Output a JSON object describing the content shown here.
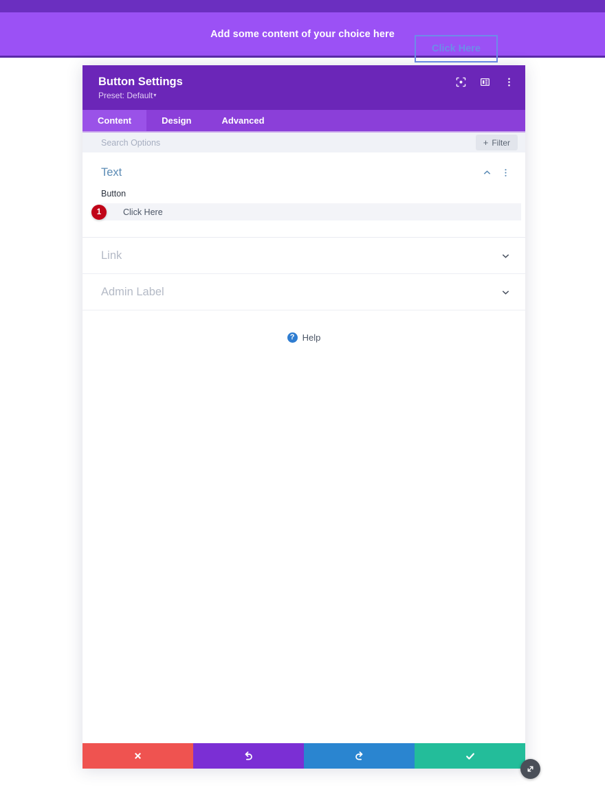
{
  "site_banner": {
    "text": "Add some content of your choice here",
    "cta_label": "Click Here",
    "bg_color": "#9b51f5",
    "top_strip_color": "#6b2fc0",
    "cta_border_color": "#6d8ce8"
  },
  "modal": {
    "title": "Button Settings",
    "preset_label": "Preset: Default",
    "preset_caret": "▾",
    "header_bg": "#6b26b8",
    "header_icons": [
      {
        "name": "focus-icon"
      },
      {
        "name": "layout-columns-icon"
      },
      {
        "name": "more-vertical-icon"
      }
    ],
    "tabs": [
      {
        "label": "Content",
        "active": true
      },
      {
        "label": "Design",
        "active": false
      },
      {
        "label": "Advanced",
        "active": false
      }
    ],
    "search": {
      "placeholder": "Search Options",
      "value": ""
    },
    "filter_button": {
      "label": "Filter",
      "plus": "+"
    },
    "sections": [
      {
        "title": "Text",
        "expanded": true,
        "title_color": "#5b8bb5",
        "fields": [
          {
            "label": "Button",
            "value": "Click Here",
            "step_badge": "1",
            "step_badge_color": "#c00418"
          }
        ]
      },
      {
        "title": "Link",
        "expanded": false
      },
      {
        "title": "Admin Label",
        "expanded": false
      }
    ],
    "help": {
      "glyph": "?",
      "label": "Help"
    },
    "footer_buttons": [
      {
        "name": "cancel-button",
        "glyph": "✖",
        "color": "#ef5350"
      },
      {
        "name": "undo-button",
        "glyph": "↺",
        "color": "#7b2fd4"
      },
      {
        "name": "redo-button",
        "glyph": "↻",
        "color": "#2a85d0"
      },
      {
        "name": "save-button",
        "glyph": "✔",
        "color": "#23bd9a"
      }
    ]
  }
}
